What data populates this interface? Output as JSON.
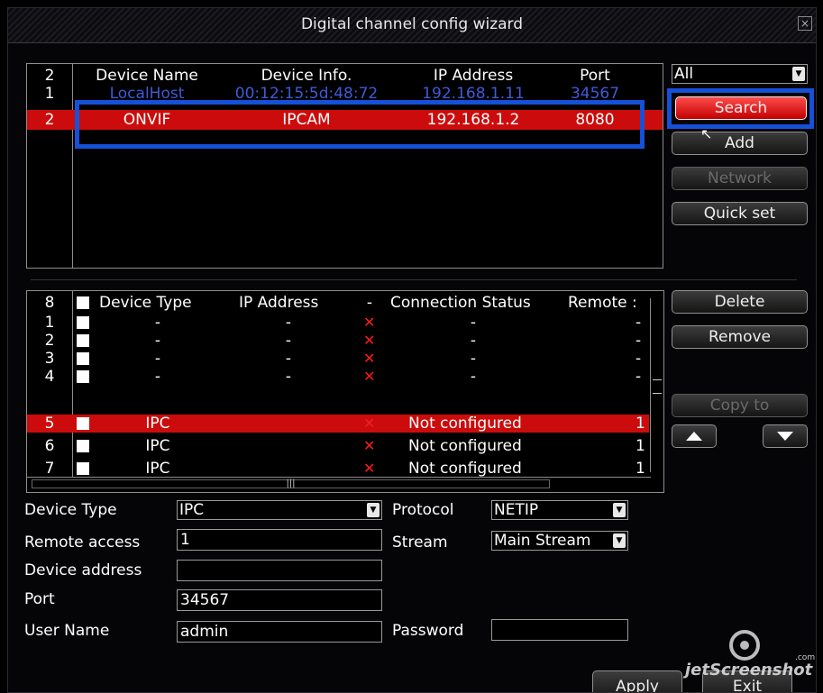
{
  "window": {
    "title": "Digital channel config wizard",
    "close_symbol": "×"
  },
  "search_panel": {
    "count": "2",
    "headers": {
      "device_name": "Device Name",
      "device_info": "Device Info.",
      "ip": "IP Address",
      "port": "Port"
    },
    "rows": [
      {
        "index": "1",
        "device_name": "LocalHost",
        "device_info": "00:12:15:5d:48:72",
        "ip": "192.168.1.11",
        "port": "34567"
      },
      {
        "index": "2",
        "device_name": "ONVIF",
        "device_info": "IPCAM",
        "ip": "192.168.1.2",
        "port": "8080"
      }
    ]
  },
  "filter": {
    "value": "All"
  },
  "buttons": {
    "search": "Search",
    "add": "Add",
    "network": "Network",
    "quick_set": "Quick set",
    "delete": "Delete",
    "remove": "Remove",
    "copy_to": "Copy to",
    "apply": "Apply",
    "exit": "Exit"
  },
  "channel_panel": {
    "count": "8",
    "headers": {
      "device_type": "Device Type",
      "ip": "IP Address",
      "dash": "-",
      "status": "Connection Status",
      "remote": "Remote :"
    },
    "rows": [
      {
        "index": "1",
        "type": "-",
        "ip": "-",
        "status": "-",
        "remote": "-"
      },
      {
        "index": "2",
        "type": "-",
        "ip": "-",
        "status": "-",
        "remote": "-"
      },
      {
        "index": "3",
        "type": "-",
        "ip": "-",
        "status": "-",
        "remote": "-"
      },
      {
        "index": "4",
        "type": "-",
        "ip": "-",
        "status": "-",
        "remote": "-"
      },
      {
        "index": "5",
        "type": "IPC",
        "ip": "",
        "status": "Not configured",
        "remote": "1"
      },
      {
        "index": "6",
        "type": "IPC",
        "ip": "",
        "status": "Not configured",
        "remote": "1"
      },
      {
        "index": "7",
        "type": "IPC",
        "ip": "",
        "status": "Not configured",
        "remote": "1"
      }
    ]
  },
  "form": {
    "device_type_label": "Device Type",
    "device_type_value": "IPC",
    "protocol_label": "Protocol",
    "protocol_value": "NETIP",
    "remote_access_label": "Remote access",
    "remote_access_value": "1",
    "stream_label": "Stream",
    "stream_value": "Main Stream",
    "device_address_label": "Device address",
    "device_address_value": "",
    "port_label": "Port",
    "port_value": "34567",
    "user_name_label": "User Name",
    "user_name_value": "admin",
    "password_label": "Password",
    "password_value": ""
  },
  "watermark": {
    "text": "jetScreenshot",
    "suffix": ".com"
  },
  "colors": {
    "highlight_red": "#cc0c0c",
    "annotation_blue": "#1550d8",
    "status_x": "#ff1a1a"
  }
}
